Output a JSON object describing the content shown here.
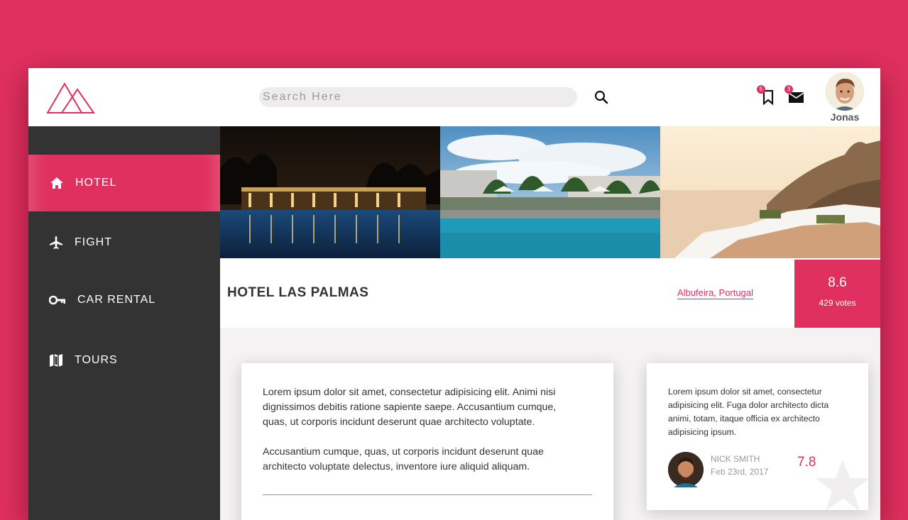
{
  "header": {
    "search_placeholder": "Search Here",
    "bookmarks_count": "5",
    "messages_count": "3",
    "user_name": "Jonas"
  },
  "sidebar": {
    "items": [
      {
        "label": "HOTEL",
        "icon": "home-icon",
        "active": true
      },
      {
        "label": "FIGHT",
        "icon": "airplane-icon",
        "active": false
      },
      {
        "label": "CAR RENTAL",
        "icon": "key-icon",
        "active": false
      },
      {
        "label": "TOURS",
        "icon": "map-icon",
        "active": false
      }
    ]
  },
  "gallery": {
    "photos": [
      "night-pool-photo",
      "day-pool-photo",
      "coastal-terrace-photo"
    ]
  },
  "hotel": {
    "name": "HOTEL LAS PALMAS",
    "location": "Albufeira, Portugal",
    "rating": "8.6",
    "votes": "429 votes"
  },
  "description": {
    "paragraph1": "Lorem ipsum dolor sit amet, consectetur adipisicing elit. Animi nisi dignissimos debitis ratione sapiente saepe. Accusantium cumque, quas, ut corporis incidunt deserunt quae architecto voluptate.",
    "paragraph2": "Accusantium cumque, quas, ut corporis incidunt deserunt quae architecto voluptate delectus, inventore iure aliquid aliquam."
  },
  "review": {
    "text": "Lorem ipsum dolor sit amet, consectetur adipisicing elit. Fuga dolor architecto dicta animi, totam, itaque officia ex architecto adipisicing ipsum.",
    "author": "NICK SMITH",
    "date": "Feb 23rd, 2017",
    "score": "7.8"
  },
  "colors": {
    "accent": "#e0305f",
    "sidebar_bg": "#333333",
    "content_bg": "#f4f2f2"
  }
}
